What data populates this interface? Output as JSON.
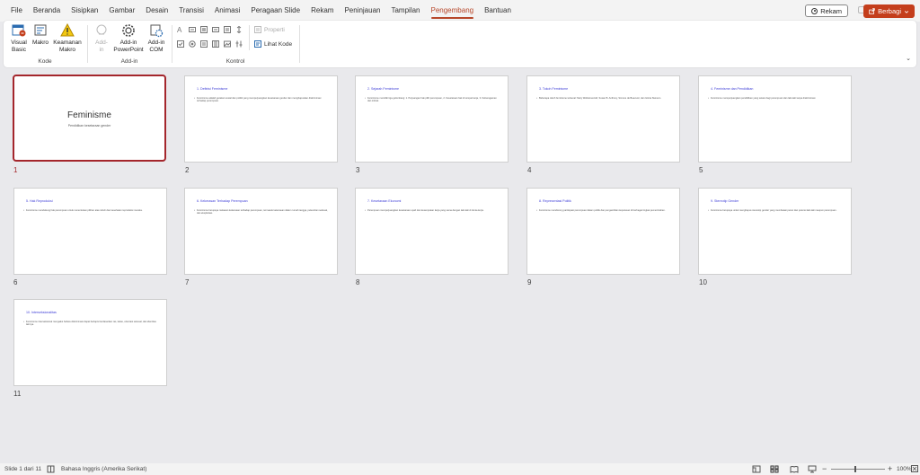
{
  "tabs": [
    "File",
    "Beranda",
    "Sisipkan",
    "Gambar",
    "Desain",
    "Transisi",
    "Animasi",
    "Peragaan Slide",
    "Rekam",
    "Peninjauan",
    "Tampilan",
    "Pengembang",
    "Bantuan"
  ],
  "header": {
    "record_label": "Rekam",
    "share_label": "Berbagi",
    "share_color": "#c43e1c"
  },
  "ribbon": {
    "groups": {
      "kode": "Kode",
      "addin": "Add-in",
      "kontrol": "Kontrol"
    },
    "visual_basic": [
      "Visual",
      "Basic"
    ],
    "makro": [
      "Makro",
      ""
    ],
    "keamanan_makro": [
      "Keamanan",
      "Makro"
    ],
    "addin_dim": [
      "Add-",
      "in"
    ],
    "addin_ppt": [
      "Add-in",
      "PowerPoint"
    ],
    "addin_com": [
      "Add-in",
      "COM"
    ],
    "properti": "Properti",
    "lihat_kode": "Lihat Kode"
  },
  "slides": [
    {
      "num": "1",
      "title": "Feminisme",
      "subtitle": "Pendidikan kesetaraan gender"
    },
    {
      "num": "2",
      "title": "1. Definisi Feminisme",
      "body": "Feminisme adalah gerakan sosial dan politik yang memperjuangkan kesetaraan gender dan menghapuskan diskriminasi terhadap perempuan."
    },
    {
      "num": "3",
      "title": "2. Sejarah Feminisme",
      "body": "Feminisme memiliki tiga gelombang: 1. Perjuangan hak pilih perempuan, 2. Kesetaraan hak di tempat kerja, 3. Keberagaman dan inklusi."
    },
    {
      "num": "4",
      "title": "3. Tokoh Feminisme",
      "body": "Beberapa tokoh feminisme terkenal: Mary Wollstonecraft, Susan B. Anthony, Simone de Beauvoir, dan Gloria Steinem."
    },
    {
      "num": "5",
      "title": "4. Feminisme dan Pendidikan",
      "body": "Feminisme memperjuangkan pendidikan yang setara bagi perempuan dan laki-laki tanpa diskriminasi."
    },
    {
      "num": "6",
      "title": "5. Hak Reproduksi",
      "body": "Feminisme mendukung hak perempuan untuk menentukan pilihan atas tubuh dan kesehatan reproduksi mereka."
    },
    {
      "num": "7",
      "title": "6. Kekerasan Terhadap Perempuan",
      "body": "Feminisme berupaya melawan kekerasan terhadap perempuan, termasuk kekerasan dalam rumah tangga, pelecehan seksual, dan eksploitasi."
    },
    {
      "num": "8",
      "title": "7. Kesetaraan Ekonomi",
      "body": "Perempuan memperjuangkan kesetaraan upah dan kesempatan kerja yang sama dengan laki-laki di dunia kerja."
    },
    {
      "num": "9",
      "title": "8. Representasi Politik",
      "body": "Feminisme mendorong partisipasi perempuan dalam politik dan pengambilan keputusan di berbagai tingkat pemerintahan."
    },
    {
      "num": "10",
      "title": "9. Stereotip Gender",
      "body": "Feminisme berupaya untuk menghapus stereotip gender yang membatasi peran dan potensi laki-laki maupun perempuan."
    },
    {
      "num": "11",
      "title": "10. Interseksionalitas",
      "body": "Feminisme interseksional mengakui bahwa diskriminasi dapat berlapis berdasarkan ras, kelas, orientasi seksual, dan identitas lainnya."
    }
  ],
  "statusbar": {
    "slide_info": "Slide 1 dari 11",
    "language": "Bahasa Inggris (Amerika Serikat)",
    "zoom": "100%",
    "zoom_fraction": 0.5
  }
}
